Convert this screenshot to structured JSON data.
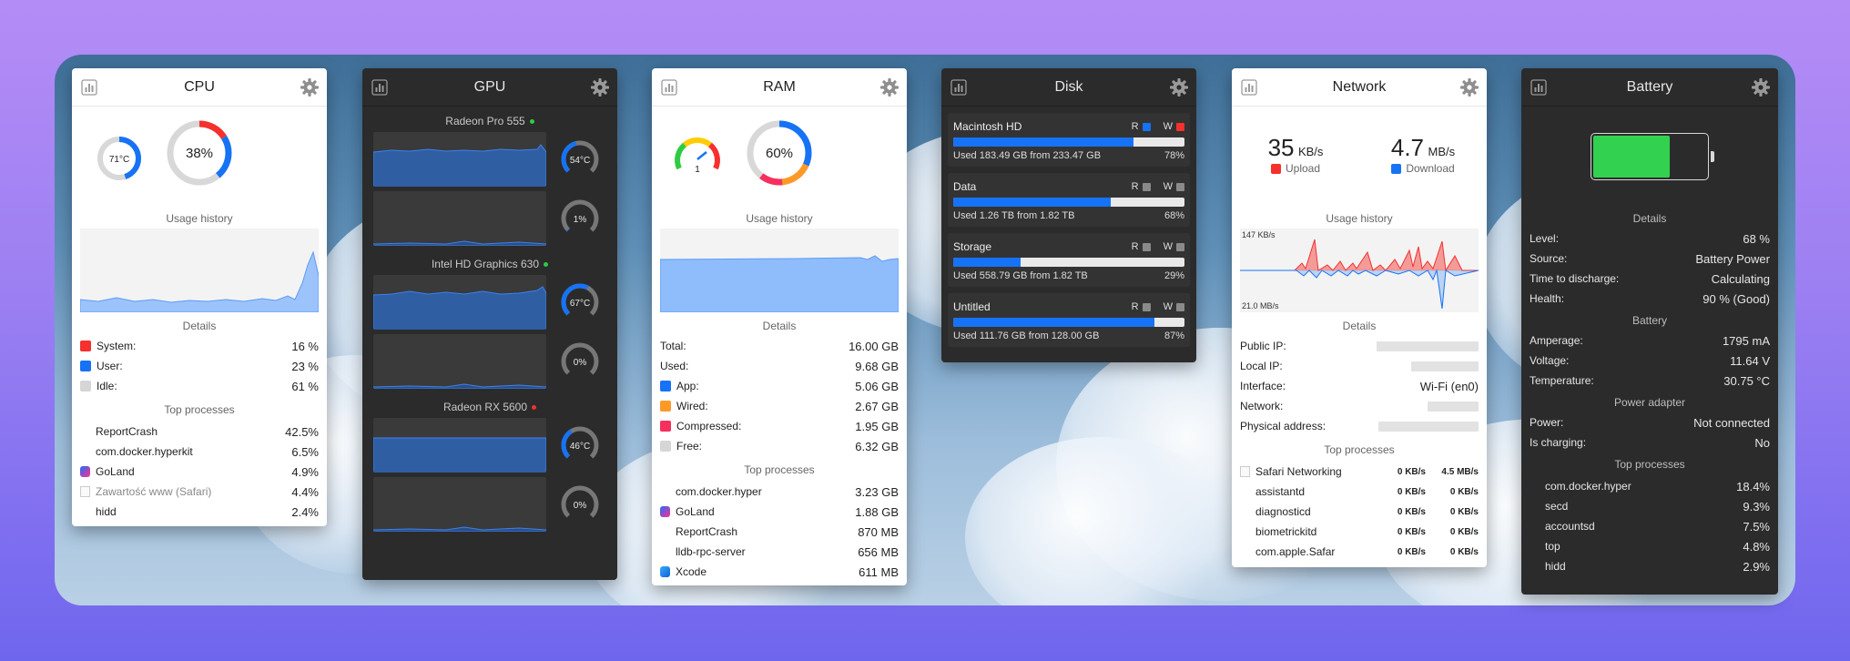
{
  "cpu": {
    "title": "CPU",
    "temp": "71°C",
    "temp_level": 0.45,
    "usage": "38%",
    "usage_level": 0.38,
    "history_label": "Usage history",
    "details_label": "Details",
    "details": [
      {
        "label": "System:",
        "value": "16 %",
        "color": "#f5302d"
      },
      {
        "label": "User:",
        "value": "23 %",
        "color": "#1773f5"
      },
      {
        "label": "Idle:",
        "value": "61 %",
        "color": "#d6d6d6"
      }
    ],
    "processes_label": "Top processes",
    "processes": [
      {
        "name": "ReportCrash",
        "value": "42.5%",
        "icon": "none"
      },
      {
        "name": "com.docker.hyperkit",
        "value": "6.5%",
        "icon": "none"
      },
      {
        "name": "GoLand",
        "value": "4.9%",
        "icon": "goland-icon"
      },
      {
        "name": "Zawartość www (Safari)",
        "value": "4.4%",
        "icon": "document-icon"
      },
      {
        "name": "hidd",
        "value": "2.4%",
        "icon": "none"
      }
    ]
  },
  "gpu": {
    "title": "GPU",
    "devices": [
      {
        "name": "Radeon Pro 555",
        "status_color": "#2ecc40",
        "temp": "54°C",
        "temp_level": 0.45,
        "util": "1%",
        "util_level": 0.01
      },
      {
        "name": "Intel HD Graphics 630",
        "status_color": "#2ecc40",
        "temp": "67°C",
        "temp_level": 0.6,
        "util": "0%",
        "util_level": 0.0
      },
      {
        "name": "Radeon RX 5600",
        "status_color": "#f5302d",
        "temp": "46°C",
        "temp_level": 0.38,
        "util": "0%",
        "util_level": 0.0
      }
    ]
  },
  "ram": {
    "title": "RAM",
    "pressure": "1",
    "usage": "60%",
    "usage_level": 0.6,
    "history_label": "Usage history",
    "details_label": "Details",
    "totals": [
      {
        "label": "Total:",
        "value": "16.00 GB"
      },
      {
        "label": "Used:",
        "value": "9.68 GB"
      }
    ],
    "details": [
      {
        "label": "App:",
        "value": "5.06 GB",
        "color": "#1773f5"
      },
      {
        "label": "Wired:",
        "value": "2.67 GB",
        "color": "#fd9a27"
      },
      {
        "label": "Compressed:",
        "value": "1.95 GB",
        "color": "#f5305c"
      },
      {
        "label": "Free:",
        "value": "6.32 GB",
        "color": "#d6d6d6"
      }
    ],
    "processes_label": "Top processes",
    "processes": [
      {
        "name": "com.docker.hyper",
        "value": "3.23 GB",
        "icon": "none"
      },
      {
        "name": "GoLand",
        "value": "1.88 GB",
        "icon": "goland-icon"
      },
      {
        "name": "ReportCrash",
        "value": "870 MB",
        "icon": "none"
      },
      {
        "name": "lldb-rpc-server",
        "value": "656 MB",
        "icon": "none"
      },
      {
        "name": "Xcode",
        "value": "611 MB",
        "icon": "xcode-icon"
      }
    ]
  },
  "disk": {
    "title": "Disk",
    "read_label": "R",
    "write_label": "W",
    "volumes": [
      {
        "name": "Macintosh HD",
        "used": "Used 183.49 GB from 233.47 GB",
        "percent": "78%",
        "level": 0.78,
        "r_color": "#1773f5",
        "w_color": "#f5302d"
      },
      {
        "name": "Data",
        "used": "Used 1.26 TB from 1.82 TB",
        "percent": "68%",
        "level": 0.68,
        "r_color": "#8a8a8a",
        "w_color": "#8a8a8a"
      },
      {
        "name": "Storage",
        "used": "Used 558.79 GB from 1.82 TB",
        "percent": "29%",
        "level": 0.29,
        "r_color": "#8a8a8a",
        "w_color": "#8a8a8a"
      },
      {
        "name": "Untitled",
        "used": "Used 111.76 GB from 128.00 GB",
        "percent": "87%",
        "level": 0.87,
        "r_color": "#8a8a8a",
        "w_color": "#8a8a8a"
      }
    ]
  },
  "network": {
    "title": "Network",
    "upload_value": "35",
    "upload_unit": "KB/s",
    "upload_label": "Upload",
    "download_value": "4.7",
    "download_unit": "MB/s",
    "download_label": "Download",
    "history_label": "Usage history",
    "chart_top": "147 KB/s",
    "chart_bottom": "21.0 MB/s",
    "details_label": "Details",
    "details": [
      {
        "label": "Public IP:",
        "value": ""
      },
      {
        "label": "Local IP:",
        "value": ""
      },
      {
        "label": "Interface:",
        "value": "Wi-Fi (en0)"
      },
      {
        "label": "Network:",
        "value": ""
      },
      {
        "label": "Physical address:",
        "value": ""
      }
    ],
    "processes_label": "Top processes",
    "processes": [
      {
        "name": "Safari Networking",
        "up": "0 KB/s",
        "down": "4.5 MB/s",
        "icon": "document-icon"
      },
      {
        "name": "assistantd",
        "up": "0 KB/s",
        "down": "0 KB/s",
        "icon": "none"
      },
      {
        "name": "diagnosticd",
        "up": "0 KB/s",
        "down": "0 KB/s",
        "icon": "none"
      },
      {
        "name": "biometrickitd",
        "up": "0 KB/s",
        "down": "0 KB/s",
        "icon": "none"
      },
      {
        "name": "com.apple.Safar",
        "up": "0 KB/s",
        "down": "0 KB/s",
        "icon": "none"
      }
    ]
  },
  "battery": {
    "title": "Battery",
    "level_fill": 0.68,
    "details_label": "Details",
    "details": [
      {
        "label": "Level:",
        "value": "68 %"
      },
      {
        "label": "Source:",
        "value": "Battery Power"
      },
      {
        "label": "Time to discharge:",
        "value": "Calculating"
      },
      {
        "label": "Health:",
        "value": "90 % (Good)"
      }
    ],
    "battery_label": "Battery",
    "battery_info": [
      {
        "label": "Amperage:",
        "value": "1795 mA"
      },
      {
        "label": "Voltage:",
        "value": "11.64 V"
      },
      {
        "label": "Temperature:",
        "value": "30.75 °C"
      }
    ],
    "adapter_label": "Power adapter",
    "adapter": [
      {
        "label": "Power:",
        "value": "Not connected"
      },
      {
        "label": "Is charging:",
        "value": "No"
      }
    ],
    "processes_label": "Top processes",
    "processes": [
      {
        "name": "com.docker.hyper",
        "value": "18.4%"
      },
      {
        "name": "secd",
        "value": "9.3%"
      },
      {
        "name": "accountsd",
        "value": "7.5%"
      },
      {
        "name": "top",
        "value": "4.8%"
      },
      {
        "name": "hidd",
        "value": "2.9%"
      }
    ]
  }
}
